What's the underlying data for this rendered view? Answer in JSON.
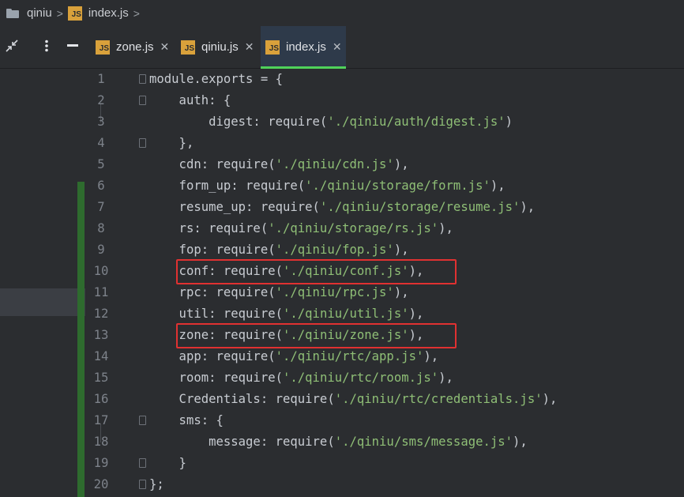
{
  "breadcrumb": {
    "folder_icon": "folder-icon",
    "items": [
      "qiniu",
      "index.js"
    ]
  },
  "toolbar": {
    "collapse_icon": "collapse-arrows-icon",
    "more_icon": "more-vertical-icon",
    "minimize_icon": "minimize-icon"
  },
  "tabs": [
    {
      "label": "zone.js",
      "icon": "js-file-icon",
      "active": false
    },
    {
      "label": "qiniu.js",
      "icon": "js-file-icon",
      "active": false
    },
    {
      "label": "index.js",
      "icon": "js-file-icon",
      "active": true
    }
  ],
  "colors": {
    "accent": "#4fd25a",
    "highlight_box": "#e03131",
    "string": "#8fbf76",
    "text": "#c8ccd2"
  },
  "code_lines": [
    {
      "n": "1",
      "pre": "module.exports = {",
      "str": "",
      "post": ""
    },
    {
      "n": "2",
      "pre": "    auth: {",
      "str": "",
      "post": ""
    },
    {
      "n": "3",
      "pre": "        digest: require(",
      "str": "'./qiniu/auth/digest.js'",
      "post": ")"
    },
    {
      "n": "4",
      "pre": "    },",
      "str": "",
      "post": ""
    },
    {
      "n": "5",
      "pre": "    cdn: require(",
      "str": "'./qiniu/cdn.js'",
      "post": "),"
    },
    {
      "n": "6",
      "pre": "    form_up: require(",
      "str": "'./qiniu/storage/form.js'",
      "post": "),"
    },
    {
      "n": "7",
      "pre": "    resume_up: require(",
      "str": "'./qiniu/storage/resume.js'",
      "post": "),"
    },
    {
      "n": "8",
      "pre": "    rs: require(",
      "str": "'./qiniu/storage/rs.js'",
      "post": "),"
    },
    {
      "n": "9",
      "pre": "    fop: require(",
      "str": "'./qiniu/fop.js'",
      "post": "),"
    },
    {
      "n": "10",
      "pre": "    conf: require(",
      "str": "'./qiniu/conf.js'",
      "post": "),"
    },
    {
      "n": "11",
      "pre": "    rpc: require(",
      "str": "'./qiniu/rpc.js'",
      "post": "),"
    },
    {
      "n": "12",
      "pre": "    util: require(",
      "str": "'./qiniu/util.js'",
      "post": "),"
    },
    {
      "n": "13",
      "pre": "    zone: require(",
      "str": "'./qiniu/zone.js'",
      "post": "),"
    },
    {
      "n": "14",
      "pre": "    app: require(",
      "str": "'./qiniu/rtc/app.js'",
      "post": "),"
    },
    {
      "n": "15",
      "pre": "    room: require(",
      "str": "'./qiniu/rtc/room.js'",
      "post": "),"
    },
    {
      "n": "16",
      "pre": "    Credentials: require(",
      "str": "'./qiniu/rtc/credentials.js'",
      "post": "),"
    },
    {
      "n": "17",
      "pre": "    sms: {",
      "str": "",
      "post": ""
    },
    {
      "n": "18",
      "pre": "        message: require(",
      "str": "'./qiniu/sms/message.js'",
      "post": "),"
    },
    {
      "n": "19",
      "pre": "    }",
      "str": "",
      "post": ""
    },
    {
      "n": "20",
      "pre": "};",
      "str": "",
      "post": ""
    }
  ]
}
